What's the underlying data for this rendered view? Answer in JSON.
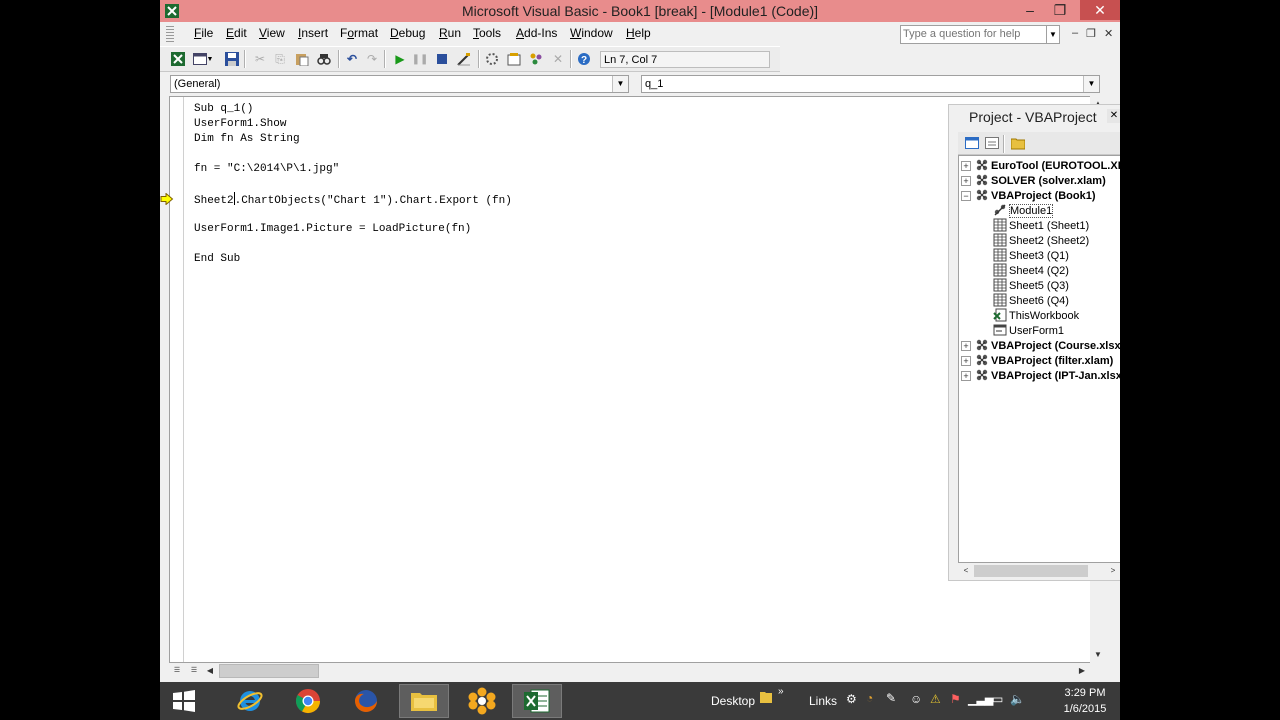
{
  "window": {
    "title": "Microsoft Visual Basic - Book1 [break] - [Module1 (Code)]"
  },
  "menu": {
    "items": [
      {
        "mn": "F",
        "rest": "ile"
      },
      {
        "mn": "E",
        "rest": "dit"
      },
      {
        "mn": "V",
        "rest": "iew"
      },
      {
        "mn": "I",
        "rest": "nsert"
      },
      {
        "pre": "F",
        "mn": "o",
        "rest": "rmat"
      },
      {
        "mn": "D",
        "rest": "ebug"
      },
      {
        "mn": "R",
        "rest": "un"
      },
      {
        "mn": "T",
        "rest": "ools"
      },
      {
        "mn": "A",
        "rest": "dd-Ins"
      },
      {
        "mn": "W",
        "rest": "indow"
      },
      {
        "mn": "H",
        "rest": "elp"
      }
    ],
    "help_placeholder": "Type a question for help"
  },
  "toolbar": {
    "position": "Ln 7, Col 7"
  },
  "code_window": {
    "object_combo": "(General)",
    "procedure_combo": "q_1",
    "lines": [
      "Sub q_1()",
      "UserForm1.Show",
      "Dim fn As String",
      "",
      "fn = \"C:\\2014\\P\\1.jpg\"",
      "",
      "Sheet2|.ChartObjects(\"Chart 1\").Chart.Export (fn)",
      "",
      "UserForm1.Image1.Picture = LoadPicture(fn)",
      "",
      "End Sub"
    ],
    "current_line_index": 6
  },
  "project": {
    "title": "Project - VBAProject",
    "tree": [
      {
        "label": "EuroTool (EUROTOOL.XLAM)",
        "bold": true,
        "level": 0,
        "expander": "+",
        "icon": "vba-project-icon"
      },
      {
        "label": "SOLVER (solver.xlam)",
        "bold": true,
        "level": 0,
        "expander": "+",
        "icon": "vba-project-icon"
      },
      {
        "label": "VBAProject (Book1)",
        "bold": true,
        "level": 0,
        "expander": "-",
        "icon": "vba-project-icon"
      },
      {
        "label": "Module1",
        "bold": false,
        "level": 1,
        "icon": "module-icon",
        "selected": true
      },
      {
        "label": "Sheet1 (Sheet1)",
        "bold": false,
        "level": 1,
        "icon": "sheet-icon"
      },
      {
        "label": "Sheet2 (Sheet2)",
        "bold": false,
        "level": 1,
        "icon": "sheet-icon"
      },
      {
        "label": "Sheet3 (Q1)",
        "bold": false,
        "level": 1,
        "icon": "sheet-icon"
      },
      {
        "label": "Sheet4 (Q2)",
        "bold": false,
        "level": 1,
        "icon": "sheet-icon"
      },
      {
        "label": "Sheet5 (Q3)",
        "bold": false,
        "level": 1,
        "icon": "sheet-icon"
      },
      {
        "label": "Sheet6 (Q4)",
        "bold": false,
        "level": 1,
        "icon": "sheet-icon"
      },
      {
        "label": "ThisWorkbook",
        "bold": false,
        "level": 1,
        "icon": "workbook-icon"
      },
      {
        "label": "UserForm1",
        "bold": false,
        "level": 1,
        "icon": "userform-icon"
      },
      {
        "label": "VBAProject (Course.xlsx)",
        "bold": true,
        "level": 0,
        "expander": "+",
        "icon": "vba-project-icon"
      },
      {
        "label": "VBAProject (filter.xlam)",
        "bold": true,
        "level": 0,
        "expander": "+",
        "icon": "vba-project-icon"
      },
      {
        "label": "VBAProject (IPT-Jan.xlsx)",
        "bold": true,
        "level": 0,
        "expander": "+",
        "icon": "vba-project-icon"
      }
    ]
  },
  "taskbar": {
    "apps": [
      "internet-explorer-icon",
      "chrome-icon",
      "firefox-icon",
      "file-explorer-icon",
      "snapshot-app-icon",
      "excel-icon"
    ],
    "desktop_label": "Desktop",
    "links_label": "Links",
    "time": "3:29 PM",
    "date": "1/6/2015"
  },
  "colors": {
    "titlebar": "#e88c8c",
    "close": "#c75050",
    "taskbar": "#3a3a3a"
  }
}
